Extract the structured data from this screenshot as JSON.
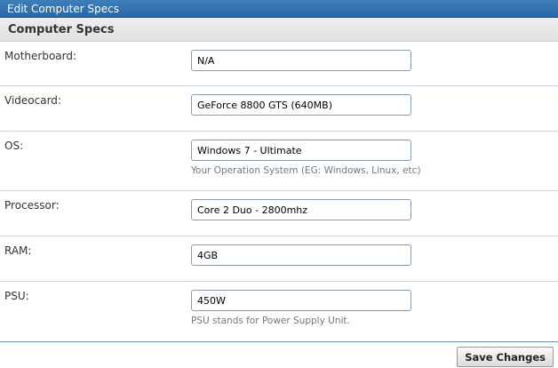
{
  "window": {
    "title": "Edit Computer Specs"
  },
  "section": {
    "title": "Computer Specs"
  },
  "fields": [
    {
      "label": "Motherboard:",
      "value": "N/A",
      "hint": ""
    },
    {
      "label": "Videocard:",
      "value": "GeForce 8800 GTS (640MB)",
      "hint": ""
    },
    {
      "label": "OS:",
      "value": "Windows 7 - Ultimate",
      "hint": "Your Operation System (EG: Windows, Linux, etc)"
    },
    {
      "label": "Processor:",
      "value": "Core 2 Duo - 2800mhz",
      "hint": ""
    },
    {
      "label": "RAM:",
      "value": "4GB",
      "hint": ""
    },
    {
      "label": "PSU:",
      "value": "450W",
      "hint": "PSU stands for Power Supply Unit."
    }
  ],
  "footer": {
    "save_label": "Save Changes"
  }
}
